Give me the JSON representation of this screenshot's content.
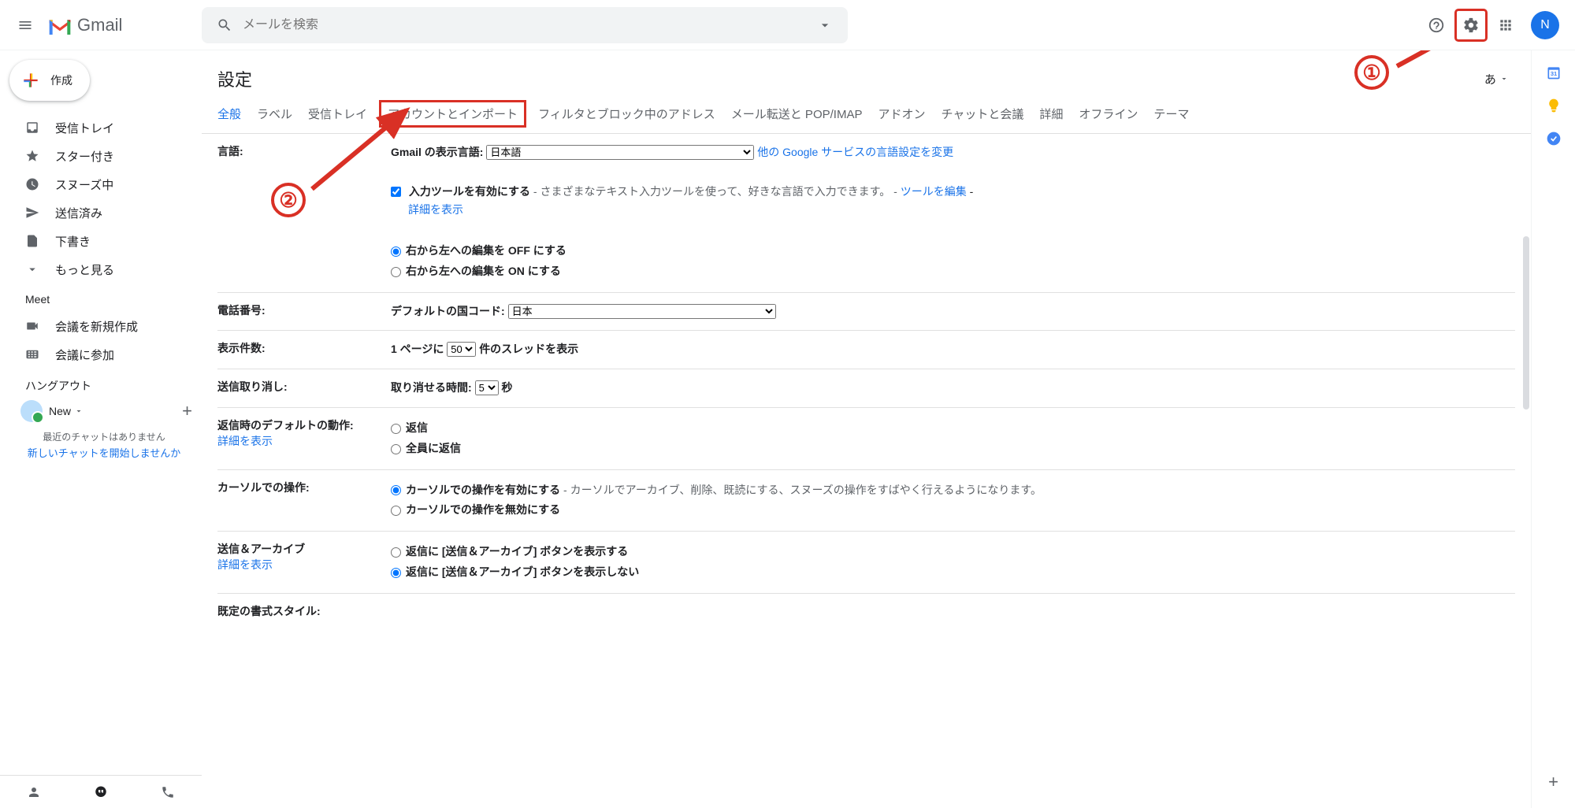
{
  "header": {
    "app_name": "Gmail",
    "search_placeholder": "メールを検索",
    "avatar_initial": "N"
  },
  "sidebar": {
    "compose_label": "作成",
    "items": [
      {
        "label": "受信トレイ"
      },
      {
        "label": "スター付き"
      },
      {
        "label": "スヌーズ中"
      },
      {
        "label": "送信済み"
      },
      {
        "label": "下書き"
      },
      {
        "label": "もっと見る"
      }
    ],
    "meet_label": "Meet",
    "meet_items": [
      {
        "label": "会議を新規作成"
      },
      {
        "label": "会議に参加"
      }
    ],
    "hangouts_label": "ハングアウト",
    "hangouts_user": "New",
    "hangouts_recent": "最近のチャットはありません",
    "hangouts_newchat": "新しいチャットを開始しませんか"
  },
  "settings": {
    "title": "設定",
    "lang_picker": "あ",
    "tabs": {
      "general": "全般",
      "labels": "ラベル",
      "inbox": "受信トレイ",
      "accounts": "アカウントとインポート",
      "filters": "フィルタとブロック中のアドレス",
      "forwarding": "メール転送と POP/IMAP",
      "addons": "アドオン",
      "chat": "チャットと会議",
      "details": "詳細",
      "offline": "オフライン",
      "theme": "テーマ"
    },
    "rows": {
      "language": {
        "label": "言語:",
        "display_lang_label": "Gmail の表示言語:",
        "display_lang_value": "日本語",
        "other_services_link": "他の Google サービスの言語設定を変更",
        "input_tool_label": "入力ツールを有効にする",
        "input_tool_desc": " - さまざまなテキスト入力ツールを使って、好きな言語で入力できます。 - ",
        "edit_tool_link": "ツールを編集",
        "sep": " - ",
        "show_details": "詳細を表示",
        "rtl_off": "右から左への編集を OFF にする",
        "rtl_on": "右から左への編集を ON にする"
      },
      "phone": {
        "label": "電話番号:",
        "country_label": "デフォルトの国コード:",
        "country_value": "日本"
      },
      "pagesize": {
        "label": "表示件数:",
        "prefix": "1 ページに ",
        "value": "50",
        "suffix": " 件のスレッドを表示"
      },
      "undo": {
        "label": "送信取り消し:",
        "prefix": "取り消せる時間: ",
        "value": "5",
        "suffix": " 秒"
      },
      "reply": {
        "label": "返信時のデフォルトの動作:",
        "details": "詳細を表示",
        "opt_reply": "返信",
        "opt_replyall": "全員に返信"
      },
      "cursor": {
        "label": "カーソルでの操作:",
        "opt_on": "カーソルでの操作を有効にする",
        "opt_on_desc": " - カーソルでアーカイブ、削除、既読にする、スヌーズの操作をすばやく行えるようになります。",
        "opt_off": "カーソルでの操作を無効にする"
      },
      "archive": {
        "label": "送信＆アーカイブ",
        "details": "詳細を表示",
        "opt_show": "返信に [送信＆アーカイブ] ボタンを表示する",
        "opt_hide": "返信に [送信＆アーカイブ] ボタンを表示しない"
      },
      "style": {
        "label": "既定の書式スタイル:"
      }
    }
  },
  "annotations": {
    "marker1": "①",
    "marker2": "②"
  }
}
